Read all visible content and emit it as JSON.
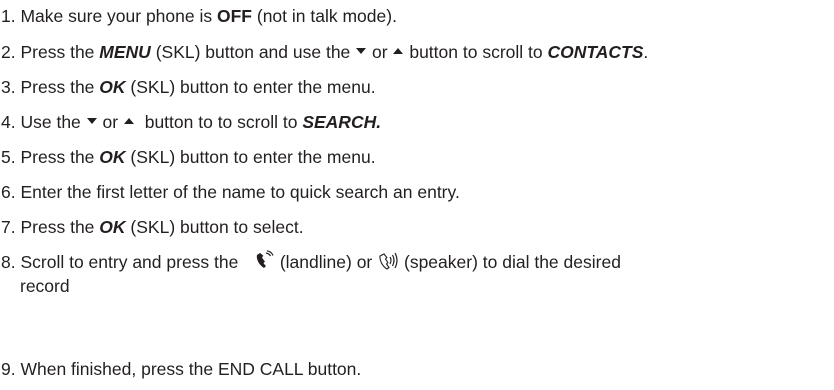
{
  "steps": [
    {
      "num": "1.",
      "t1": "Make sure your phone is",
      "b1": "OFF",
      "t2": "(not in talk mode)."
    },
    {
      "num": "2.",
      "t1": "Press the",
      "b1": "MENU",
      "t2": "(SKL) button and use the",
      "t3": "or",
      "t4": "button to scroll to",
      "b2": "CONTACTS",
      "t5": "."
    },
    {
      "num": "3.",
      "t1": "Press the",
      "b1": "OK",
      "t2": "(SKL) button to enter the menu."
    },
    {
      "num": "4.",
      "t1": "Use the",
      "t2": "or",
      "t3": "button to to scroll to",
      "b1": "SEARCH."
    },
    {
      "num": "5.",
      "t1": "Press the",
      "b1": "OK",
      "t2": "(SKL) button to enter the menu."
    },
    {
      "num": "6.",
      "t1": "Enter the first letter of the name to quick search an entry."
    },
    {
      "num": "7.",
      "t1": "Press the",
      "b1": "OK",
      "t2": "(SKL) button to select."
    },
    {
      "num": "8.",
      "t1": "Scroll to entry and press the",
      "t2": "(landline) or",
      "t3": "(speaker) to dial the desired",
      "t4": "record"
    },
    {
      "num": "9.",
      "t1": "When finished, press the END CALL button."
    }
  ],
  "icons": {
    "down": "down-arrow-icon",
    "up": "up-arrow-icon",
    "landline": "landline-handset-icon",
    "speaker": "speakerphone-icon"
  }
}
